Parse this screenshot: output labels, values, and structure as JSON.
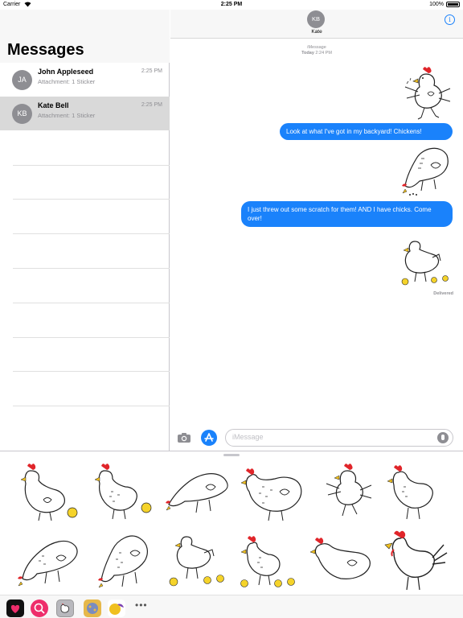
{
  "status": {
    "carrier": "Carrier",
    "time": "2:25 PM",
    "battery": "100%"
  },
  "messages_list": {
    "title": "Messages",
    "conversations": [
      {
        "initials": "JA",
        "name": "John Appleseed",
        "time": "2:25 PM",
        "preview": "Attachment: 1 Sticker",
        "selected": false
      },
      {
        "initials": "KB",
        "name": "Kate Bell",
        "time": "2:25 PM",
        "preview": "Attachment: 1 Sticker",
        "selected": true
      }
    ]
  },
  "thread": {
    "contact_initials": "KB",
    "contact_name": "Kate",
    "info_label": "i",
    "service": "iMessage",
    "timestamp_day": "Today",
    "timestamp_time": "2:24 PM",
    "messages": [
      {
        "type": "sticker",
        "icon": "dancing-chicken"
      },
      {
        "type": "text",
        "text": "Look at what I've got in my backyard! Chickens!"
      },
      {
        "type": "sticker",
        "icon": "pecking-chicken"
      },
      {
        "type": "text",
        "text": "I just threw out some scratch for them! AND I have chicks. Come over!"
      },
      {
        "type": "sticker",
        "icon": "hen-with-chicks"
      }
    ],
    "delivered": "Delivered",
    "input_placeholder": "iMessage"
  },
  "sticker_drawer": {
    "stickers": [
      "hen-with-chick",
      "hen-with-chick-2",
      "pecking-hen",
      "fat-hen",
      "dancing-chicken",
      "rooster-standing",
      "pecking-hen-2",
      "pecking-hen-3",
      "hen-with-chicks",
      "rooster-with-chicks",
      "hen-walking",
      "rooster-crowing"
    ],
    "tray_icons": [
      "stickers-app-icon",
      "search-stickers-icon",
      "chicken-pack-icon",
      "sticker-pack-2-icon",
      "sticker-pack-3-icon"
    ],
    "more_label": "•••"
  },
  "colors": {
    "accent": "#1a82fb",
    "comb": "#e0252a",
    "beak": "#f0c020",
    "chick": "#f5d32a"
  }
}
